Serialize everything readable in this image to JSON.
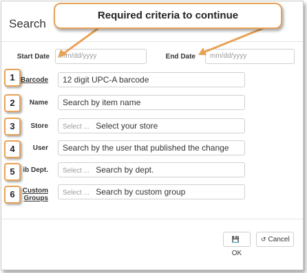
{
  "dialog": {
    "title": "Search"
  },
  "callout": {
    "text": "Required criteria to continue"
  },
  "dates": {
    "start_label": "Start Date",
    "start_placeholder": "mm/dd/yyyy",
    "end_label": "End Date",
    "end_placeholder": "mm/dd/yyyy"
  },
  "fields": {
    "barcode": {
      "label": "Barcode",
      "value": "12 digit UPC-A barcode"
    },
    "name": {
      "label": "Name",
      "value": "Search by item name"
    },
    "store": {
      "label": "Store",
      "placeholder": "Select ...",
      "value": "Select your store"
    },
    "user": {
      "label": "User",
      "value": "Search by the user that published the change"
    },
    "dept": {
      "label": "ib Dept.",
      "placeholder": "Select ...",
      "value": "Search by dept."
    },
    "groups": {
      "label_line1": "Custom",
      "label_line2": "Groups",
      "placeholder": "Select ...",
      "value": "Search by custom group"
    }
  },
  "badges": [
    "1",
    "2",
    "3",
    "4",
    "5",
    "6"
  ],
  "buttons": {
    "ok_label": "OK",
    "ok_icon": "save-icon",
    "cancel_label": "Cancel",
    "cancel_icon": "undo-icon"
  },
  "colors": {
    "callout_border": "#e8a256"
  }
}
